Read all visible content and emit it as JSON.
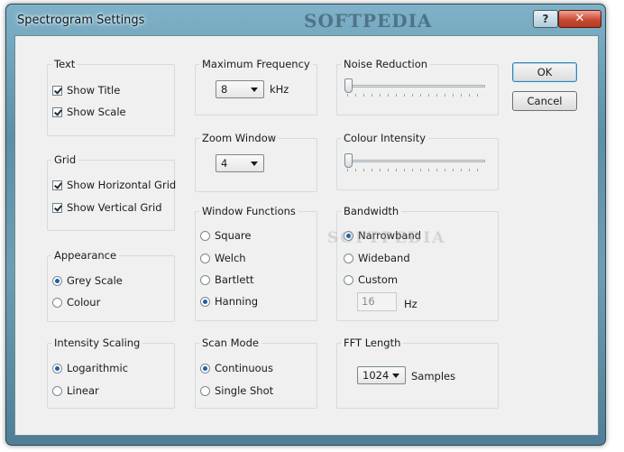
{
  "window": {
    "title": "Spectrogram Settings",
    "watermark_top": "SOFTPEDIA",
    "watermark_mid": "SOFTPEDIA",
    "help_label": "?",
    "close_label": "✕"
  },
  "text_group": {
    "title": "Text",
    "show_title": {
      "label": "Show Title",
      "checked": true
    },
    "show_scale": {
      "label": "Show Scale",
      "checked": true
    }
  },
  "grid_group": {
    "title": "Grid",
    "show_horizontal": {
      "label": "Show Horizontal Grid",
      "checked": true
    },
    "show_vertical": {
      "label": "Show Vertical Grid",
      "checked": true
    }
  },
  "appearance_group": {
    "title": "Appearance",
    "options": [
      "Grey Scale",
      "Colour"
    ],
    "selected": "Grey Scale"
  },
  "intensity_group": {
    "title": "Intensity Scaling",
    "options": [
      "Logarithmic",
      "Linear"
    ],
    "selected": "Logarithmic"
  },
  "max_freq_group": {
    "title": "Maximum Frequency",
    "value": "8",
    "unit": "kHz"
  },
  "zoom_group": {
    "title": "Zoom Window",
    "value": "4"
  },
  "window_functions_group": {
    "title": "Window Functions",
    "options": [
      "Square",
      "Welch",
      "Bartlett",
      "Hanning"
    ],
    "selected": "Hanning"
  },
  "scan_mode_group": {
    "title": "Scan Mode",
    "options": [
      "Continuous",
      "Single Shot"
    ],
    "selected": "Continuous"
  },
  "noise_group": {
    "title": "Noise Reduction",
    "level": 0
  },
  "colour_intensity_group": {
    "title": "Colour Intensity",
    "level": 0
  },
  "bandwidth_group": {
    "title": "Bandwidth",
    "options": [
      "Narrowband",
      "Wideband",
      "Custom"
    ],
    "selected": "Narrowband",
    "custom_value": "16",
    "custom_unit": "Hz"
  },
  "fft_group": {
    "title": "FFT Length",
    "value": "1024",
    "unit": "Samples"
  },
  "buttons": {
    "ok": "OK",
    "cancel": "Cancel"
  }
}
